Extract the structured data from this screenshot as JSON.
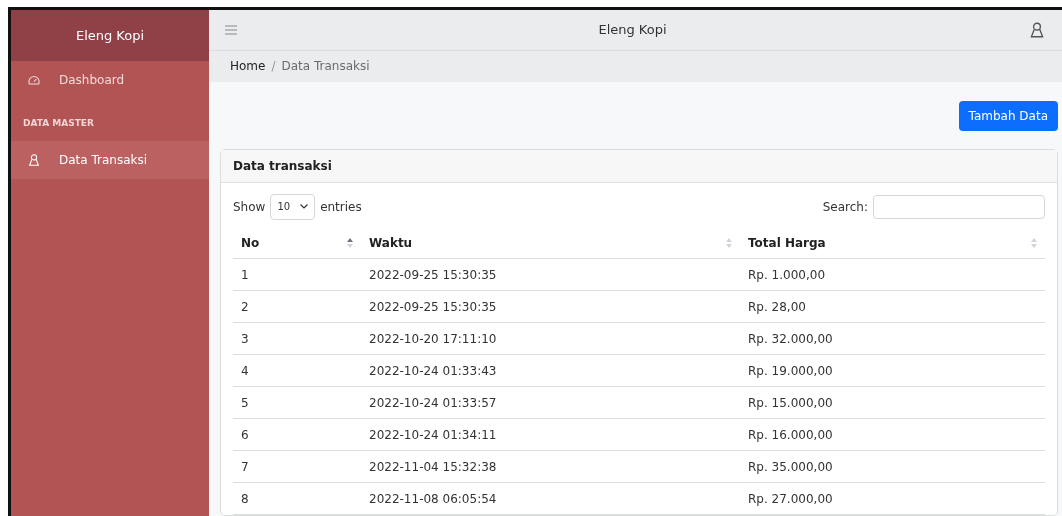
{
  "sidebar": {
    "brand": "Eleng Kopi",
    "items": [
      {
        "kind": "gauge-link",
        "label": "Dashboard",
        "selected": false
      },
      {
        "kind": "heading",
        "label": "DATA MASTER"
      },
      {
        "kind": "user-link",
        "label": "Data Transaksi",
        "selected": true
      }
    ]
  },
  "topbar": {
    "title": "Eleng Kopi"
  },
  "breadcrumb": {
    "separator": "/",
    "items": [
      {
        "label": "Home",
        "current": false
      },
      {
        "label": "Data Transaksi",
        "current": true
      }
    ]
  },
  "add_button": "Tambah Data",
  "card": {
    "title": "Data transaksi",
    "length": {
      "before": "Show",
      "value": "10",
      "after": "entries"
    },
    "search": {
      "label": "Search:"
    },
    "table": {
      "columns": [
        {
          "label": "No",
          "sorted": true
        },
        {
          "label": "Waktu",
          "sorted": false
        },
        {
          "label": "Total Harga",
          "sorted": false
        }
      ],
      "rows": [
        [
          "1",
          "2022-09-25 15:30:35",
          "Rp. 1.000,00"
        ],
        [
          "2",
          "2022-09-25 15:30:35",
          "Rp. 28,00"
        ],
        [
          "3",
          "2022-10-20 17:11:10",
          "Rp. 32.000,00"
        ],
        [
          "4",
          "2022-10-24 01:33:43",
          "Rp. 19.000,00"
        ],
        [
          "5",
          "2022-10-24 01:33:57",
          "Rp. 15.000,00"
        ],
        [
          "6",
          "2022-10-24 01:34:11",
          "Rp. 16.000,00"
        ],
        [
          "7",
          "2022-11-04 15:32:38",
          "Rp. 35.000,00"
        ],
        [
          "8",
          "2022-11-08 06:05:54",
          "Rp. 27.000,00"
        ]
      ]
    }
  }
}
